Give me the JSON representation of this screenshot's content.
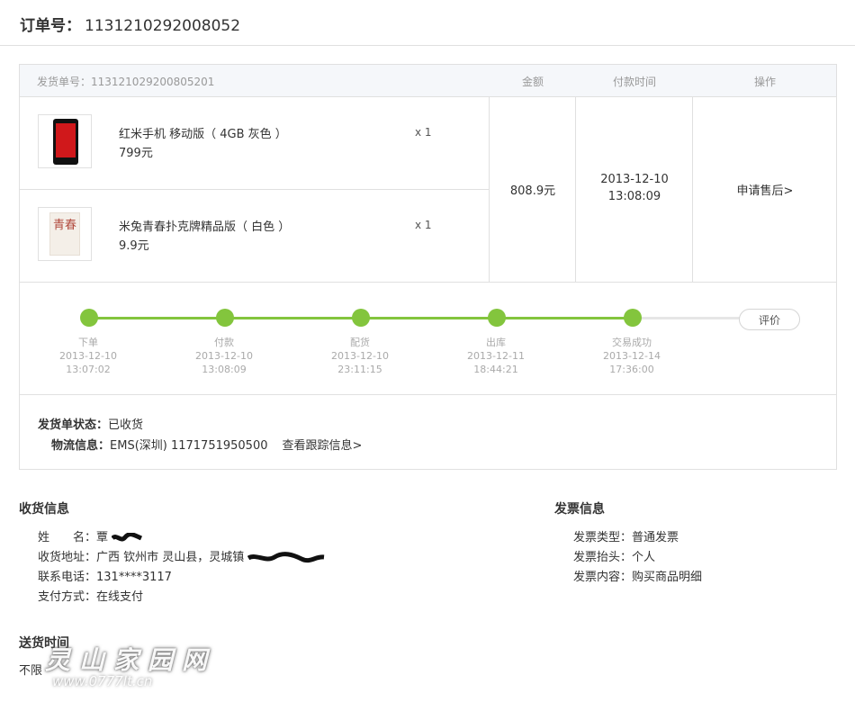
{
  "order": {
    "label": "订单号：",
    "number": "1131210292008052"
  },
  "header": {
    "shipment": "发货单号：113121029200805201",
    "amount_col": "金额",
    "paytime_col": "付款时间",
    "action_col": "操作"
  },
  "items": [
    {
      "name": "红米手机 移动版（ 4GB 灰色 ）",
      "price": "799元",
      "qty": "x 1",
      "icon": "phone-thumbnail"
    },
    {
      "name": "米兔青春扑克牌精品版（ 白色 ）",
      "price": "9.9元",
      "qty": "x 1",
      "icon": "playing-cards-thumbnail",
      "thumb_text": "青春"
    }
  ],
  "summary": {
    "amount": "808.9元",
    "pay_date": "2013-12-10",
    "pay_time": "13:08:09",
    "after_sale": "申请售后>"
  },
  "progress": {
    "steps": [
      {
        "label": "下单",
        "date": "2013-12-10",
        "time": "13:07:02"
      },
      {
        "label": "付款",
        "date": "2013-12-10",
        "time": "13:08:09"
      },
      {
        "label": "配货",
        "date": "2013-12-10",
        "time": "23:11:15"
      },
      {
        "label": "出库",
        "date": "2013-12-11",
        "time": "18:44:21"
      },
      {
        "label": "交易成功",
        "date": "2013-12-14",
        "time": "17:36:00"
      }
    ],
    "review_label": "评价",
    "active_color": "#83c53d",
    "inactive_color": "#e6e6e6"
  },
  "shipping": {
    "status_label": "发货单状态：",
    "status_value": "已收货",
    "logistics_label": "物流信息：",
    "logistics_value": "EMS(深圳) 1171751950500",
    "track_link": "查看跟踪信息>"
  },
  "receiver": {
    "title": "收货信息",
    "name_label": "姓　　名：",
    "name_value": "覃",
    "address_label": "收货地址：",
    "address_value": "广西 钦州市 灵山县，灵城镇",
    "phone_label": "联系电话：",
    "phone_value": "131****3117",
    "pay_label": "支付方式：",
    "pay_value": "在线支付"
  },
  "invoice": {
    "title": "发票信息",
    "type_label": "发票类型：",
    "type_value": "普通发票",
    "header_label": "发票抬头：",
    "header_value": "个人",
    "content_label": "发票内容：",
    "content_value": "购买商品明细"
  },
  "delivery": {
    "title": "送货时间",
    "value": "不限"
  },
  "watermark": {
    "text": "灵山家园网",
    "url": "www.0777lt.cn"
  }
}
